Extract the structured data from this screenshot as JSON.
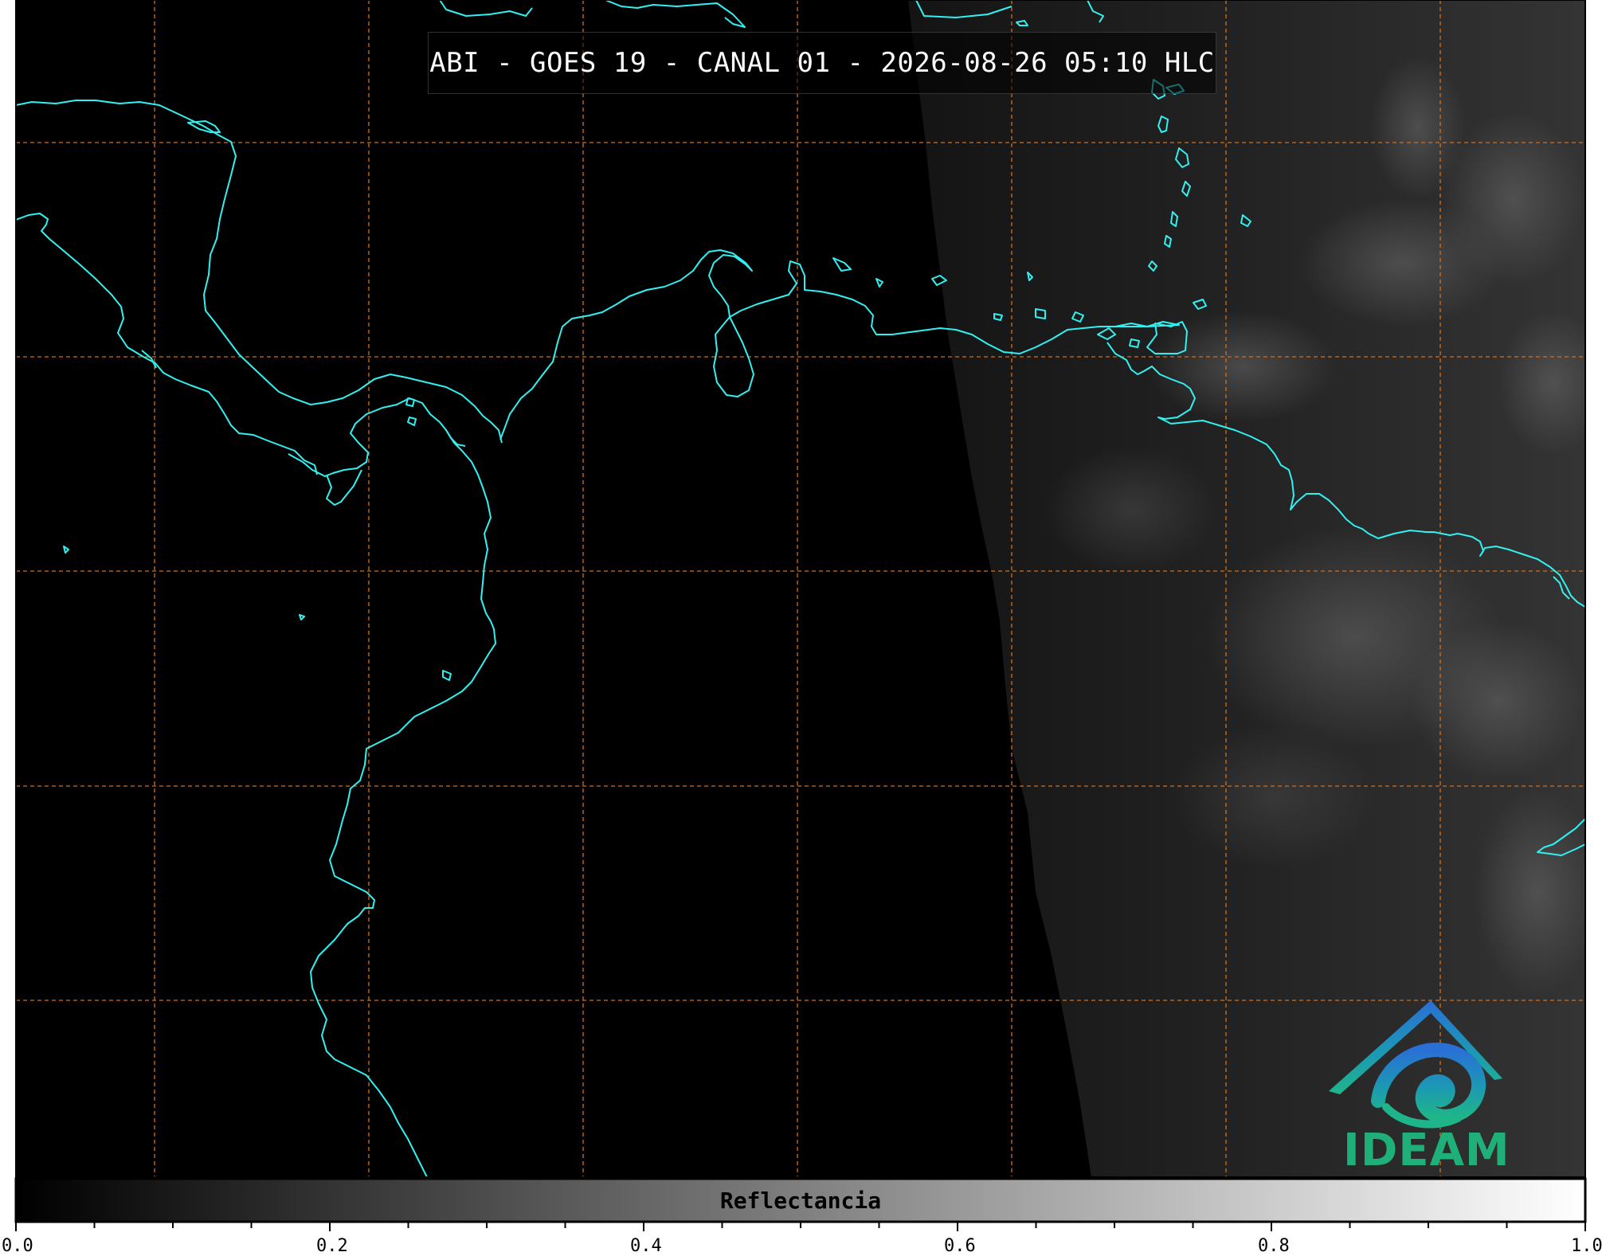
{
  "title": "ABI - GOES 19 - CANAL 01 - 2026-08-26 05:10 HLC",
  "colorbar": {
    "label": "Reflectancia",
    "ticks": [
      "0.0",
      "0.2",
      "0.4",
      "0.6",
      "0.8",
      "1.0"
    ],
    "range": [
      0.0,
      1.0
    ],
    "colormap": [
      "#000000",
      "#ffffff"
    ]
  },
  "logo": {
    "text": "IDEAM",
    "color": "#1fb07a"
  },
  "colors": {
    "coastline": "#33f0f0",
    "gridlines": "#d07020",
    "background": "#000000"
  }
}
